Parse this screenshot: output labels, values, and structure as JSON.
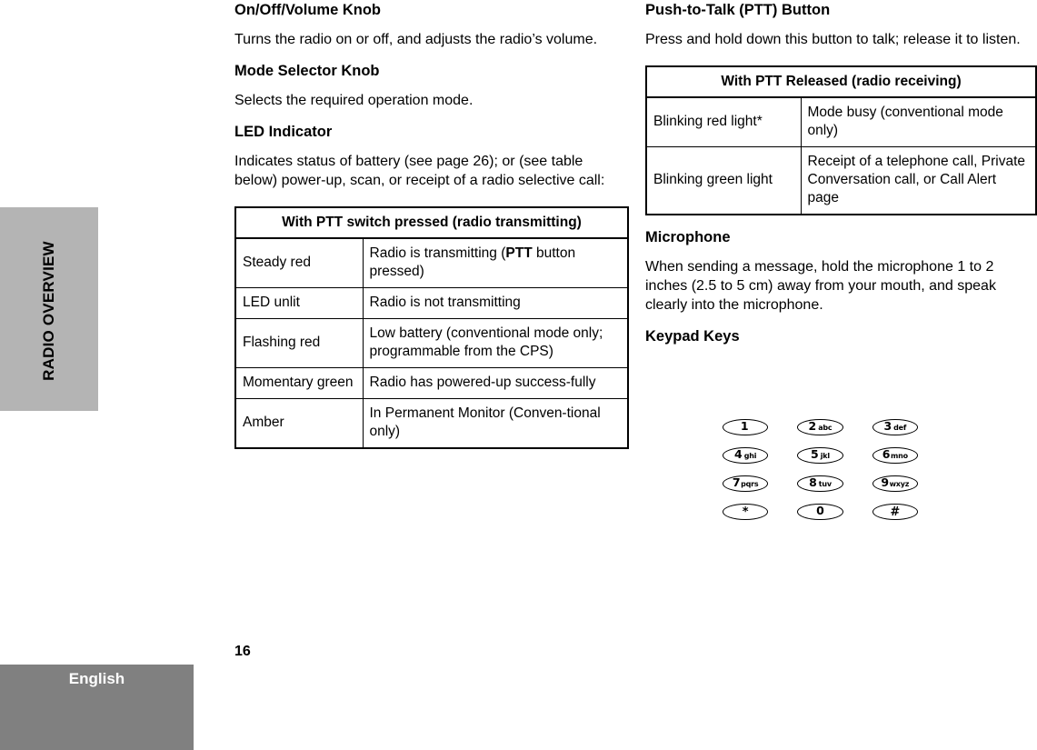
{
  "tab": {
    "label": "RADIO OVERVIEW"
  },
  "footer": {
    "language": "English",
    "page_number": "16"
  },
  "left_column": {
    "sections": [
      {
        "heading": "On/Off/Volume Knob",
        "body": "Turns the radio on or off, and adjusts the radio’s volume."
      },
      {
        "heading": "Mode Selector Knob",
        "body": "Selects the required operation mode."
      },
      {
        "heading": "LED Indicator",
        "body": "Indicates status of battery (see page 26); or (see table below) power-up, scan, or receipt of a radio selective call:"
      }
    ],
    "table": {
      "caption": "With PTT switch pressed (radio transmitting)",
      "rows": [
        {
          "state": "Steady red",
          "meaning_pre": "Radio is transmitting (",
          "meaning_bold": "PTT",
          "meaning_post": " button pressed)"
        },
        {
          "state": "LED unlit",
          "meaning_pre": "Radio is not transmitting",
          "meaning_bold": "",
          "meaning_post": ""
        },
        {
          "state": "Flashing red",
          "meaning_pre": "Low battery (conventional mode only; programmable from the CPS)",
          "meaning_bold": "",
          "meaning_post": ""
        },
        {
          "state": "Momentary green",
          "meaning_pre": "Radio has powered-up success-fully",
          "meaning_bold": "",
          "meaning_post": ""
        },
        {
          "state": "Amber",
          "meaning_pre": "In Permanent Monitor (Conven-tional only)",
          "meaning_bold": "",
          "meaning_post": ""
        }
      ]
    }
  },
  "right_column": {
    "section_ptt": {
      "heading": "Push-to-Talk (PTT) Button",
      "body": "Press and hold down this button to talk; release it to listen."
    },
    "table": {
      "caption": "With PTT Released (radio receiving)",
      "rows": [
        {
          "state": "Blinking red light*",
          "meaning": "Mode busy (conventional mode only)"
        },
        {
          "state": "Blinking green light",
          "meaning": "Receipt of a telephone call, Private Conversation call, or Call Alert page"
        }
      ]
    },
    "section_microphone": {
      "heading": "Microphone",
      "body": "When sending a message, hold the microphone 1 to 2 inches (2.5 to 5 cm) away from your mouth, and speak clearly into the microphone."
    },
    "section_keypad": {
      "heading": "Keypad Keys",
      "keys": [
        [
          {
            "digit": "1",
            "letters": ""
          },
          {
            "digit": "2",
            "letters": "abc"
          },
          {
            "digit": "3",
            "letters": "def"
          }
        ],
        [
          {
            "digit": "4",
            "letters": "ghi"
          },
          {
            "digit": "5",
            "letters": "jkl"
          },
          {
            "digit": "6",
            "letters": "mno"
          }
        ],
        [
          {
            "digit": "7",
            "letters": "pqrs"
          },
          {
            "digit": "8",
            "letters": "tuv"
          },
          {
            "digit": "9",
            "letters": "wxyz"
          }
        ],
        [
          {
            "digit": "*",
            "letters": ""
          },
          {
            "digit": "0",
            "letters": ""
          },
          {
            "digit": "#",
            "letters": ""
          }
        ]
      ]
    }
  },
  "colors": {
    "tab_gray": "#b4b4b4",
    "footer_gray": "#808080",
    "text": "#000000",
    "page_background": "#ffffff"
  }
}
